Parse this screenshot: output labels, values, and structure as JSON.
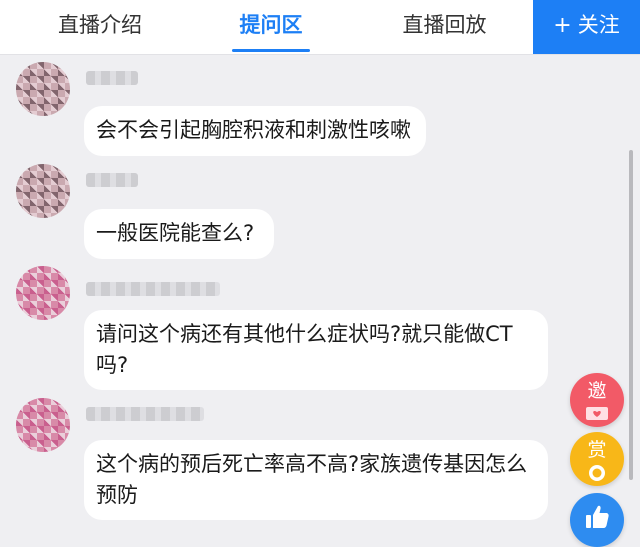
{
  "tabs": [
    {
      "label": "直播介绍",
      "active": false
    },
    {
      "label": "提问区",
      "active": true
    },
    {
      "label": "直播回放",
      "active": false
    }
  ],
  "follow_button": {
    "icon": "plus-icon",
    "label": "关注"
  },
  "messages": [
    {
      "text": "会不会引起胸腔积液和刺激性咳嗽"
    },
    {
      "text": "一般医院能查么?"
    },
    {
      "text": "请问这个病还有其他什么症状吗?就只能做CT吗?"
    },
    {
      "text": "这个病的预后死亡率高不高?家族遗传基因怎么预防"
    }
  ],
  "floating_actions": [
    {
      "label": "邀",
      "icon": "envelope-heart-icon",
      "color": "#f25a67"
    },
    {
      "label": "赏",
      "icon": "coin-icon",
      "color": "#f8b718"
    },
    {
      "icon": "thumbs-up-icon",
      "color": "#2e8cf0"
    }
  ],
  "colors": {
    "accent": "#1d7ff5",
    "background": "#efeff2"
  }
}
